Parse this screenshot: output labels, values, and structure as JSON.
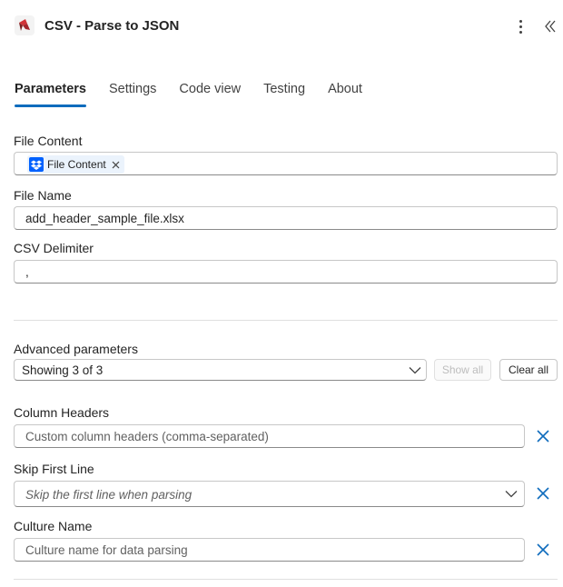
{
  "header": {
    "title": "CSV - Parse to JSON",
    "logo_icon": "plumsail-logo-icon",
    "more_icon": "more-vertical-icon",
    "collapse_icon": "chevron-double-left-icon"
  },
  "tabs": [
    {
      "label": "Parameters",
      "active": true
    },
    {
      "label": "Settings",
      "active": false
    },
    {
      "label": "Code view",
      "active": false
    },
    {
      "label": "Testing",
      "active": false
    },
    {
      "label": "About",
      "active": false
    }
  ],
  "params": {
    "file_content": {
      "label": "File Content",
      "token_label": "File Content",
      "token_icon": "dropbox-icon"
    },
    "file_name": {
      "label": "File Name",
      "value": "add_header_sample_file.xlsx"
    },
    "csv_delimiter": {
      "label": "CSV Delimiter",
      "value": ","
    }
  },
  "advanced": {
    "label": "Advanced parameters",
    "select_value": "Showing 3 of 3",
    "show_all": "Show all",
    "clear_all": "Clear all"
  },
  "advanced_fields": {
    "column_headers": {
      "label": "Column Headers",
      "placeholder": "Custom column headers (comma-separated)"
    },
    "skip_first_line": {
      "label": "Skip First Line",
      "placeholder": "Skip the first line when parsing"
    },
    "culture_name": {
      "label": "Culture Name",
      "placeholder": "Culture name for data parsing"
    }
  },
  "colors": {
    "accent": "#0f6cbd",
    "remove": "#0f6cbd",
    "dropbox": "#0061fe",
    "logo_red": "#d13438"
  }
}
